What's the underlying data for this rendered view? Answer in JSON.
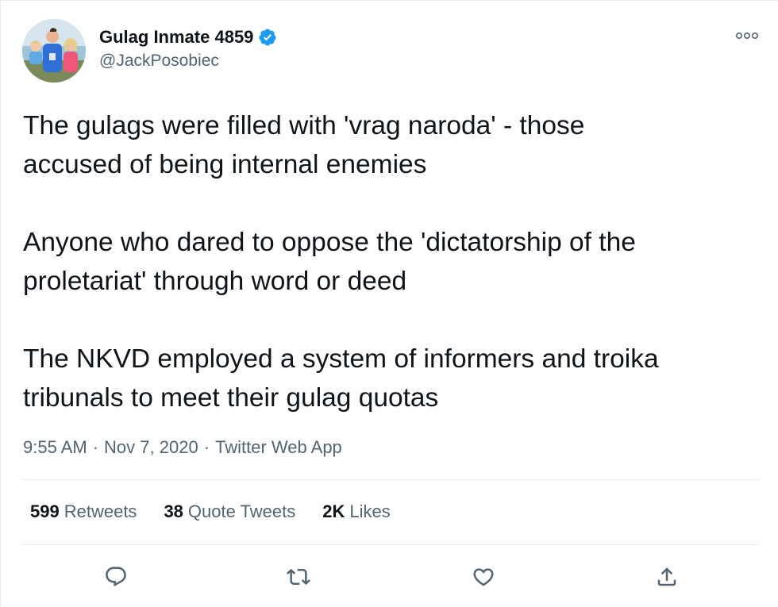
{
  "author": {
    "display_name": "Gulag Inmate 4859",
    "handle": "@JackPosobiec",
    "verified": true,
    "avatar_icon": "family-photo-avatar"
  },
  "tweet": {
    "paragraphs": [
      "The gulags were filled with 'vrag naroda' - those\naccused of being internal enemies",
      "Anyone who dared to oppose the 'dictatorship of the\nproletariat' through word or deed",
      "The NKVD employed a system of informers and troika\ntribunals to meet their gulag quotas"
    ]
  },
  "meta": {
    "time": "9:55 AM",
    "separator": "·",
    "date": "Nov 7, 2020",
    "source": "Twitter Web App"
  },
  "stats": {
    "retweets": {
      "count": "599",
      "label": "Retweets"
    },
    "quote_tweets": {
      "count": "38",
      "label": "Quote Tweets"
    },
    "likes": {
      "count": "2K",
      "label": "Likes"
    }
  },
  "actions": {
    "reply_icon": "reply-icon",
    "retweet_icon": "retweet-icon",
    "like_icon": "heart-icon",
    "share_icon": "share-icon"
  },
  "colors": {
    "text": "#0f1419",
    "secondary": "#536471",
    "divider": "#e6ecf0",
    "verified_blue": "#1d9bf0"
  }
}
